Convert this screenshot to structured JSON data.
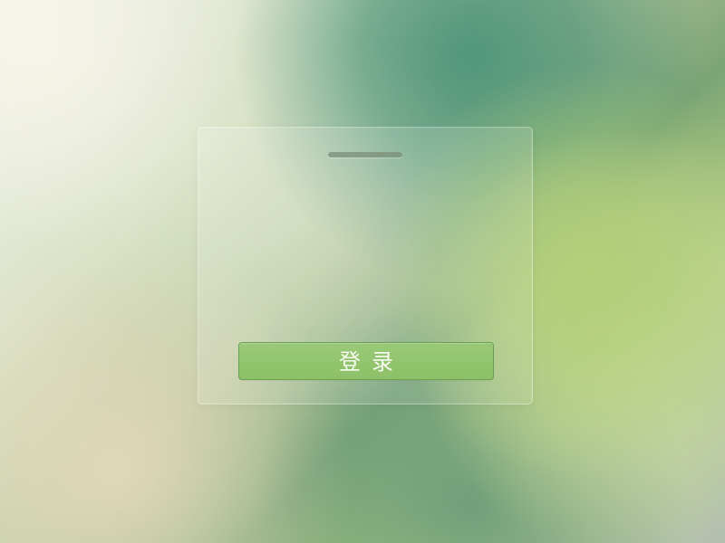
{
  "login_card": {
    "handle_icon": "drag-handle-icon",
    "button_label": "登录"
  },
  "colors": {
    "button": "#8dc067",
    "card_overlay": "#ffffff",
    "handle": "#7d9178"
  }
}
